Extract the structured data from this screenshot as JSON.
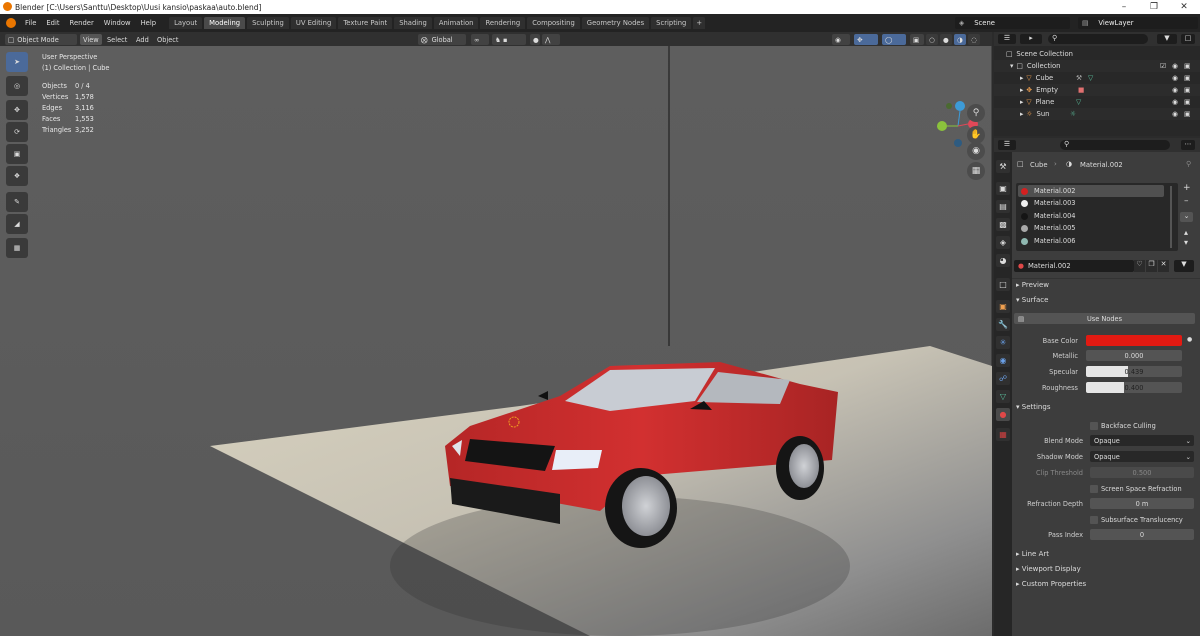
{
  "window": {
    "title": "Blender [C:\\Users\\Santtu\\Desktop\\Uusi kansio\\paskaa\\auto.blend]"
  },
  "menu": [
    "File",
    "Edit",
    "Render",
    "Window",
    "Help"
  ],
  "workspaces": [
    "Layout",
    "Modeling",
    "Sculpting",
    "UV Editing",
    "Texture Paint",
    "Shading",
    "Animation",
    "Rendering",
    "Compositing",
    "Geometry Nodes",
    "Scripting"
  ],
  "active_workspace": "Modeling",
  "scene": "Scene",
  "view_layer": "ViewLayer",
  "viewport": {
    "mode": "Object Mode",
    "menus": [
      "View",
      "Select",
      "Add",
      "Object"
    ],
    "orientation": "Global",
    "perspective": "User Perspective",
    "collection_info": "(1) Collection | Cube",
    "stats": [
      {
        "label": "Objects",
        "value": "0 / 4"
      },
      {
        "label": "Vertices",
        "value": "1,578"
      },
      {
        "label": "Edges",
        "value": "3,116"
      },
      {
        "label": "Faces",
        "value": "1,553"
      },
      {
        "label": "Triangles",
        "value": "3,252"
      }
    ]
  },
  "outliner": {
    "root": "Scene Collection",
    "collection": "Collection",
    "objects": [
      "Cube",
      "Empty",
      "Plane",
      "Sun"
    ]
  },
  "properties": {
    "breadcrumb_object": "Cube",
    "breadcrumb_material": "Material.002",
    "material_slots": [
      {
        "name": "Material.002",
        "color": "#d42020"
      },
      {
        "name": "Material.003",
        "color": "#f0f0f0"
      },
      {
        "name": "Material.004",
        "color": "#151515"
      },
      {
        "name": "Material.005",
        "color": "#a9a9a9"
      },
      {
        "name": "Material.006",
        "color": "#8fb8b0"
      }
    ],
    "active_material": "Material.002",
    "panels": {
      "preview": "Preview",
      "surface": "Surface",
      "settings": "Settings",
      "line_art": "Line Art",
      "viewport_display": "Viewport Display",
      "custom_properties": "Custom Properties"
    },
    "use_nodes": "Use Nodes",
    "surface": {
      "base_color_label": "Base Color",
      "base_color": "#e21a12",
      "metallic_label": "Metallic",
      "metallic": "0.000",
      "metallic_fill": 0,
      "specular_label": "Specular",
      "specular": "0.439",
      "specular_fill": 0.439,
      "roughness_label": "Roughness",
      "roughness": "0.400",
      "roughness_fill": 0.4
    },
    "settings": {
      "backface_culling": "Backface Culling",
      "blend_mode_label": "Blend Mode",
      "blend_mode": "Opaque",
      "shadow_mode_label": "Shadow Mode",
      "shadow_mode": "Opaque",
      "clip_threshold_label": "Clip Threshold",
      "clip_threshold": "0.500",
      "ssr": "Screen Space Refraction",
      "refraction_depth_label": "Refraction Depth",
      "refraction_depth": "0 m",
      "sss": "Subsurface Translucency",
      "pass_index_label": "Pass Index",
      "pass_index": "0"
    }
  },
  "colors": {
    "accent": "#4b6a9a",
    "car": "#c82a2a",
    "floor": "#e6e1d2"
  }
}
